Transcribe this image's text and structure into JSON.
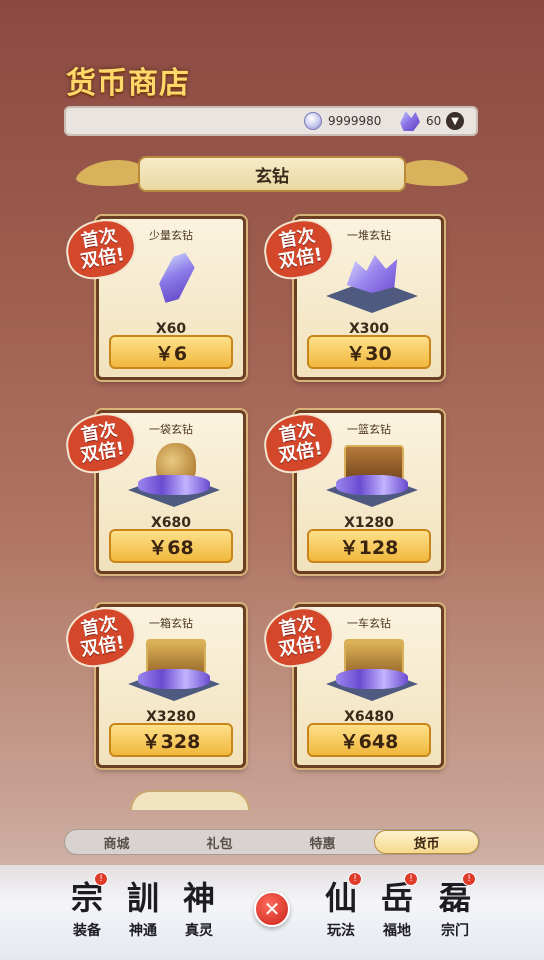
{
  "page": {
    "title": "货币商店"
  },
  "currency": {
    "coin_amount": "9999980",
    "gem_amount": "60",
    "coin_icon": "jade-coin-icon",
    "gem_icon": "purple-crystal-icon"
  },
  "section": {
    "label": "玄钻"
  },
  "badge": {
    "line1": "首次",
    "line2": "双倍!"
  },
  "products": [
    {
      "name": "少量玄钻",
      "qty": "X60",
      "price": "￥6"
    },
    {
      "name": "一堆玄钻",
      "qty": "X300",
      "price": "￥30"
    },
    {
      "name": "一袋玄钻",
      "qty": "X680",
      "price": "￥68"
    },
    {
      "name": "一篮玄钻",
      "qty": "X1280",
      "price": "￥128"
    },
    {
      "name": "一箱玄钻",
      "qty": "X3280",
      "price": "￥328"
    },
    {
      "name": "一车玄钻",
      "qty": "X6480",
      "price": "￥648"
    }
  ],
  "tabs": [
    "商城",
    "礼包",
    "特惠",
    "货币"
  ],
  "active_tab": "货币",
  "nav": [
    {
      "glyph": "宗",
      "label": "装备",
      "alert": "!"
    },
    {
      "glyph": "訓",
      "label": "神通",
      "alert": ""
    },
    {
      "glyph": "神",
      "label": "真灵",
      "alert": ""
    },
    {
      "glyph": "仙",
      "label": "玩法",
      "alert": "!"
    },
    {
      "glyph": "岳",
      "label": "福地",
      "alert": "!"
    },
    {
      "glyph": "磊",
      "label": "宗门",
      "alert": "!"
    }
  ],
  "close_label": "✕"
}
